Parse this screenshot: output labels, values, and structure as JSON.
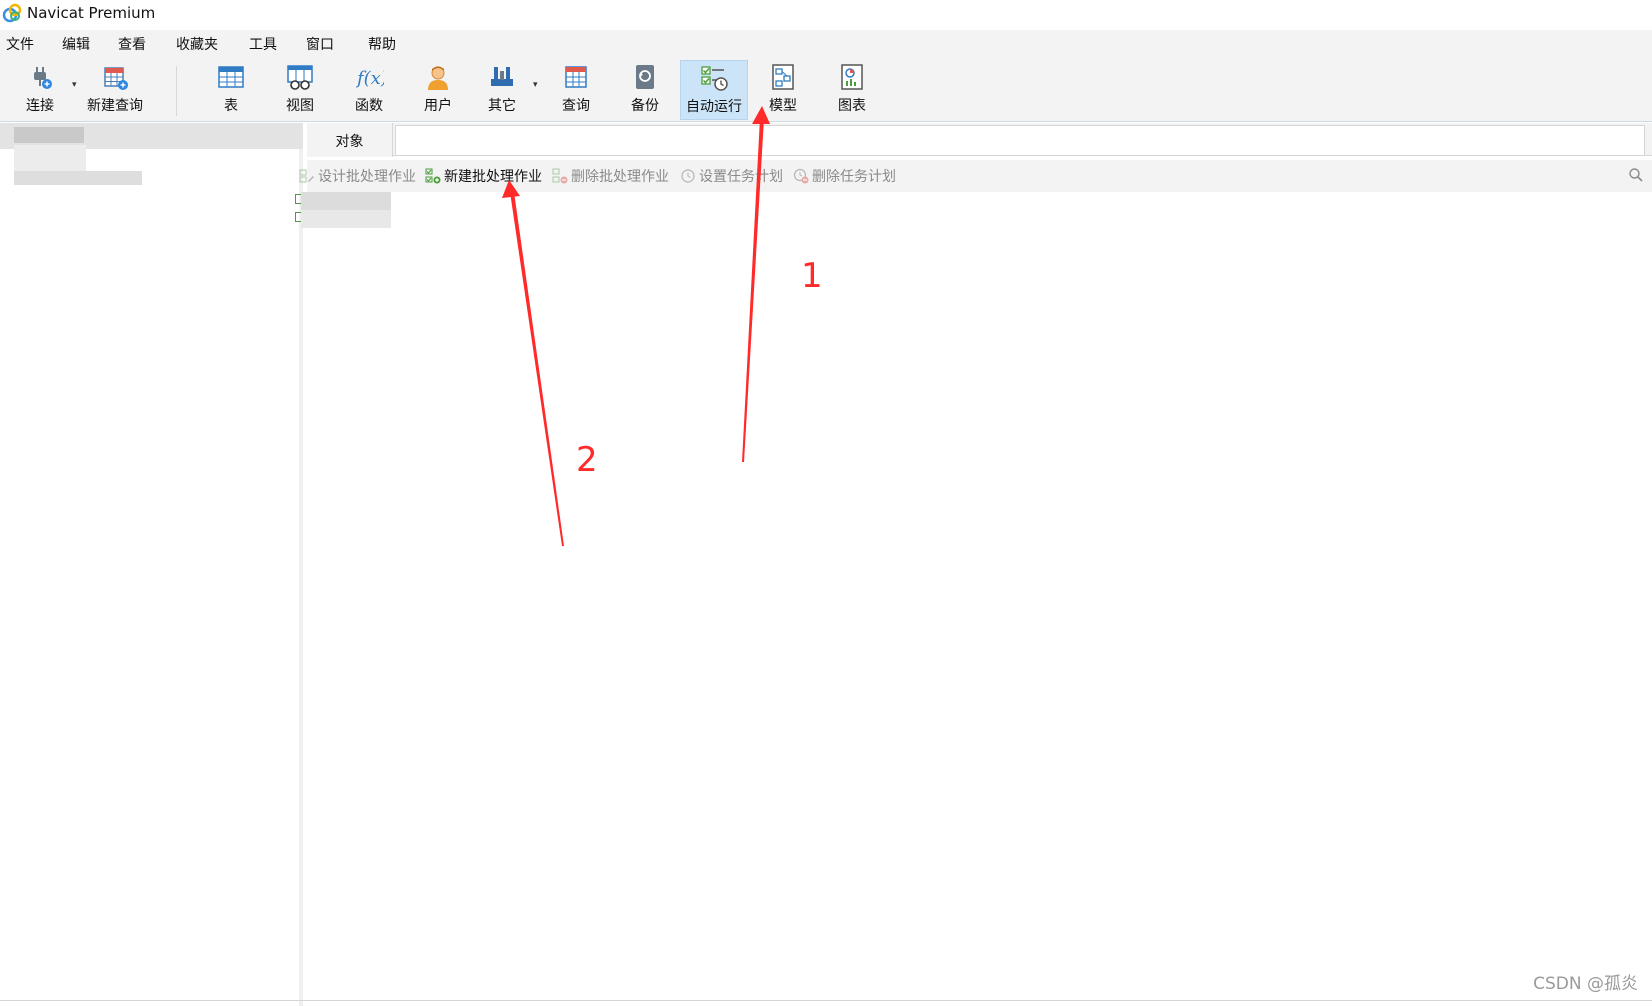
{
  "window": {
    "title": "Navicat Premium"
  },
  "menu": [
    "文件",
    "编辑",
    "查看",
    "收藏夹",
    "工具",
    "窗口",
    "帮助"
  ],
  "toolbar": {
    "connect": "连接",
    "new_query": "新建查询",
    "table": "表",
    "view": "视图",
    "function": "函数",
    "user": "用户",
    "other": "其它",
    "query": "查询",
    "backup": "备份",
    "automation": "自动运行",
    "model": "模型",
    "chart": "图表",
    "caret": "▾"
  },
  "tabs": {
    "objects": "对象"
  },
  "object_toolbar": {
    "design_batch_job": "设计批处理作业",
    "new_batch_job": "新建批处理作业",
    "delete_batch_job": "删除批处理作业",
    "set_schedule": "设置任务计划",
    "delete_schedule": "删除任务计划"
  },
  "annotations": {
    "label_1": "1",
    "label_2": "2"
  },
  "watermark": "CSDN @孤炎",
  "colors": {
    "accent_active": "#cce4f7",
    "annotation_red": "#ff2a2a",
    "toolbar_bg": "#f3f3f3"
  }
}
